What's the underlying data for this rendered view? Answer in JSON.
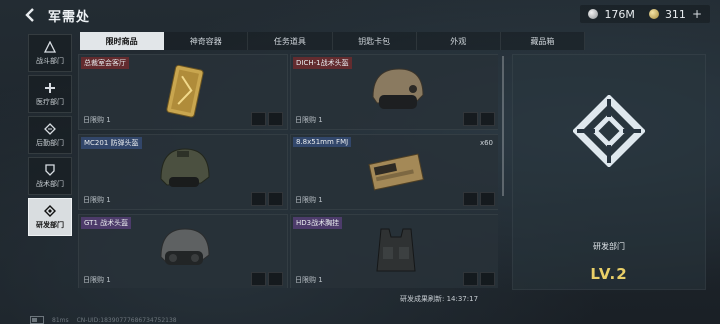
{
  "header": {
    "title": "军需处"
  },
  "resources": [
    {
      "icon": "silver-coin-icon",
      "value": "176M"
    },
    {
      "icon": "gold-coin-icon",
      "value": "311"
    }
  ],
  "sidebar": {
    "items": [
      {
        "label": "战斗部门",
        "icon": "combat-icon",
        "active": false
      },
      {
        "label": "医疗部门",
        "icon": "medical-icon",
        "active": false
      },
      {
        "label": "后勤部门",
        "icon": "logistics-icon",
        "active": false
      },
      {
        "label": "战术部门",
        "icon": "tactical-icon",
        "active": false
      },
      {
        "label": "研发部门",
        "icon": "research-icon",
        "active": true
      }
    ]
  },
  "tabs": [
    {
      "label": "限时商品",
      "active": true
    },
    {
      "label": "神奇容器",
      "active": false
    },
    {
      "label": "任务道具",
      "active": false
    },
    {
      "label": "钥匙卡包",
      "active": false
    },
    {
      "label": "外观",
      "active": false
    },
    {
      "label": "藏品箱",
      "active": false
    }
  ],
  "items": [
    {
      "name": "总裁室会客厅",
      "rarity": "red",
      "limit": "日限购 1",
      "count": "",
      "art": "keycard"
    },
    {
      "name": "DICH-1战术头盔",
      "rarity": "red",
      "limit": "日限购 1",
      "count": "",
      "art": "helmet-tan"
    },
    {
      "name": "MC201 防弹头盔",
      "rarity": "blue",
      "limit": "日限购 1",
      "count": "",
      "art": "helmet-olive"
    },
    {
      "name": "8.8x51mm FMJ",
      "rarity": "blue",
      "limit": "日限购 1",
      "count": "x60",
      "art": "ammo-box"
    },
    {
      "name": "GT1 战术头盔",
      "rarity": "purple",
      "limit": "日限购 1",
      "count": "",
      "art": "helmet-grey"
    },
    {
      "name": "HD3战术胸挂",
      "rarity": "purple",
      "limit": "日限购 1",
      "count": "",
      "art": "chest-rig"
    }
  ],
  "right_panel": {
    "department": "研发部门",
    "level": "LV.2"
  },
  "refresh": {
    "text": "研发成果刷新: 14:37:17"
  },
  "footer": {
    "ping": "81ms",
    "uid": "CN-UID:18390777686734752138"
  },
  "colors": {
    "accent_gold": "#e9cf68",
    "rarity_red": "#962828",
    "rarity_blue": "#3c5a96",
    "rarity_purple": "#6e4696"
  }
}
